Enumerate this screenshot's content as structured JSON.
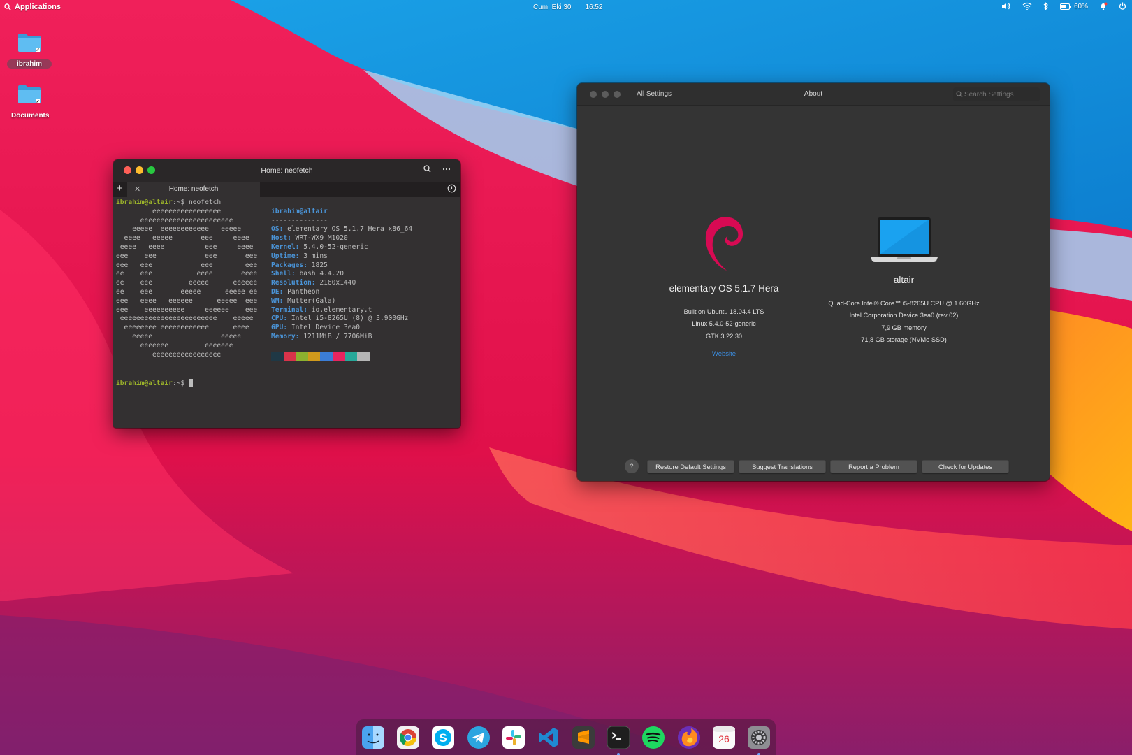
{
  "top_panel": {
    "applications_label": "Applications",
    "date": "Cum, Eki 30",
    "time": "16:52",
    "battery_percent": "60%"
  },
  "desktop": {
    "icons": [
      {
        "label": "ibrahim"
      },
      {
        "label": "Documents"
      }
    ]
  },
  "terminal": {
    "title": "Home: neofetch",
    "tab_label": "Home: neofetch",
    "command_line": "ibrahim@altair:~$ neofetch",
    "prompt_user": "ibrahim@altair",
    "prompt_suffix": ":~$ ",
    "command": "neofetch",
    "logo_lines": [
      "         eeeeeeeeeeeeeeeee",
      "      eeeeeeeeeeeeeeeeeeeeeee",
      "    eeeee  eeeeeeeeeeee   eeeee",
      "  eeee   eeeee       eee     eeee",
      " eeee   eeee          eee     eeee",
      "eee    eee            eee       eee",
      "eee   eee            eee        eee",
      "ee    eee           eeee       eeee",
      "ee    eee         eeeee      eeeeee",
      "ee    eee       eeeee      eeeee ee",
      "eee   eeee   eeeeee      eeeee  eee",
      "eee    eeeeeeeeee     eeeeee    eee",
      " eeeeeeeeeeeeeeeeeeeeeeee    eeeee",
      "  eeeeeeee eeeeeeeeeeee      eeee",
      "    eeeee                 eeeee",
      "      eeeeeee         eeeeeee",
      "         eeeeeeeeeeeeeeeee"
    ],
    "user_host": "ibrahim@altair",
    "separator": "--------------",
    "info": [
      {
        "key": "OS",
        "value": "elementary OS 5.1.7 Hera x86_64"
      },
      {
        "key": "Host",
        "value": "WRT-WX9 M1020"
      },
      {
        "key": "Kernel",
        "value": "5.4.0-52-generic"
      },
      {
        "key": "Uptime",
        "value": "3 mins"
      },
      {
        "key": "Packages",
        "value": "1825"
      },
      {
        "key": "Shell",
        "value": "bash 4.4.20"
      },
      {
        "key": "Resolution",
        "value": "2160x1440"
      },
      {
        "key": "DE",
        "value": "Pantheon"
      },
      {
        "key": "WM",
        "value": "Mutter(Gala)"
      },
      {
        "key": "Terminal",
        "value": "io.elementary.t"
      },
      {
        "key": "CPU",
        "value": "Intel i5-8265U (8) @ 3.900GHz"
      },
      {
        "key": "GPU",
        "value": "Intel Device 3ea0"
      },
      {
        "key": "Memory",
        "value": "1211MiB / 7706MiB"
      }
    ],
    "palette": [
      "#1f3845",
      "#d8334a",
      "#8cb12f",
      "#d19a1c",
      "#3b7dd6",
      "#e8255f",
      "#27a899",
      "#b5b5b5"
    ]
  },
  "settings": {
    "back_label": "All Settings",
    "title": "About",
    "search_placeholder": "Search Settings",
    "os": {
      "name": "elementary OS 5.1.7 Hera",
      "details": [
        "Built on Ubuntu 18.04.4 LTS",
        "Linux 5.4.0-52-generic",
        "GTK 3.22.30"
      ],
      "website_label": "Website"
    },
    "hardware": {
      "name": "altair",
      "details": [
        "Quad-Core Intel® Core™ i5-8265U CPU @ 1.60GHz",
        "Intel Corporation Device 3ea0 (rev 02)",
        "7,9 GB memory",
        "71,8 GB storage (NVMe SSD)"
      ]
    },
    "help_label": "?",
    "buttons": [
      "Restore Default Settings",
      "Suggest Translations",
      "Report a Problem",
      "Check for Updates"
    ]
  },
  "dock": {
    "apps": [
      {
        "icon": "finder-icon"
      },
      {
        "icon": "chrome-icon"
      },
      {
        "icon": "skype-icon"
      },
      {
        "icon": "telegram-icon"
      },
      {
        "icon": "slack-icon"
      },
      {
        "icon": "vscode-icon"
      },
      {
        "icon": "sublime-text-icon"
      },
      {
        "icon": "terminal-icon",
        "running": true
      },
      {
        "icon": "spotify-icon"
      },
      {
        "icon": "firefox-icon"
      },
      {
        "icon": "calendar-icon",
        "label": "26"
      },
      {
        "icon": "system-settings-icon",
        "running": true
      }
    ]
  },
  "colors": {
    "accent": "#3b8de0",
    "terminal_prompt": "#9bb22a",
    "terminal_key": "#4a93d6",
    "debian_red": "#d70a53"
  }
}
